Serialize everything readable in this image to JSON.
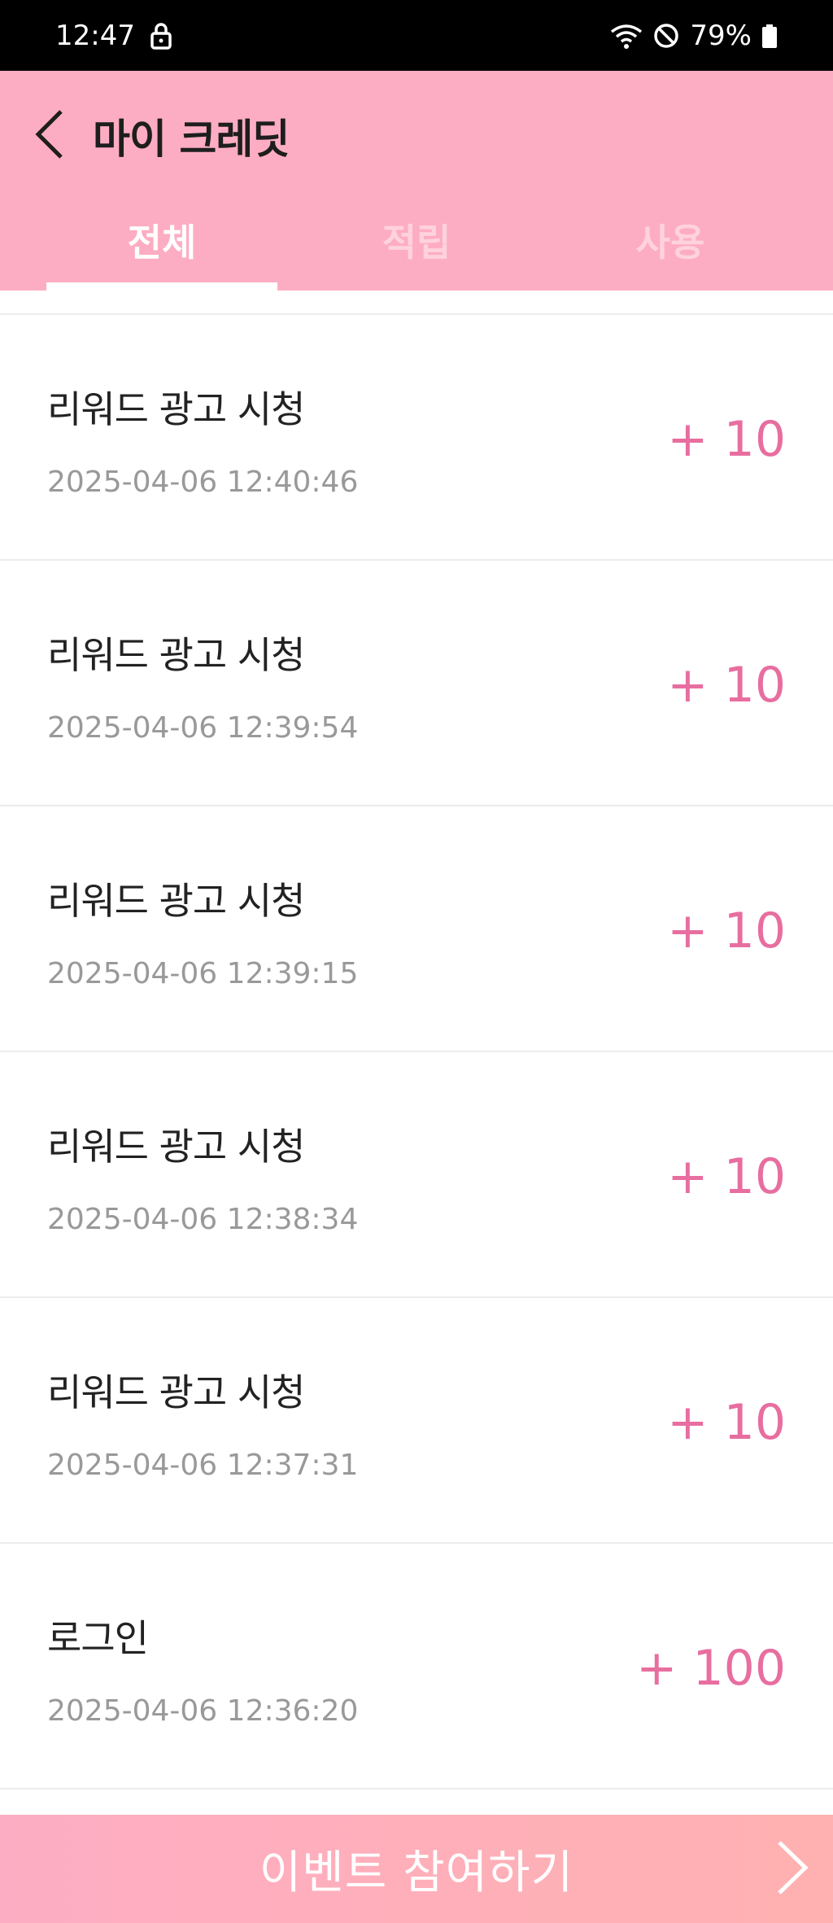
{
  "status_bar": {
    "time": "12:47",
    "battery": "79%",
    "icons": [
      "lock-icon",
      "wifi-icon",
      "do-not-disturb-icon",
      "battery-icon"
    ]
  },
  "header": {
    "title": "마이 크레딧",
    "back_icon": "chevron-left-icon",
    "tabs": [
      {
        "label": "전체",
        "active": true
      },
      {
        "label": "적립",
        "active": false
      },
      {
        "label": "사용",
        "active": false
      }
    ]
  },
  "transactions": [
    {
      "title": "리워드 광고 시청",
      "date": "2025-04-06 12:40:46",
      "amount": "+ 10"
    },
    {
      "title": "리워드 광고 시청",
      "date": "2025-04-06 12:39:54",
      "amount": "+ 10"
    },
    {
      "title": "리워드 광고 시청",
      "date": "2025-04-06 12:39:15",
      "amount": "+ 10"
    },
    {
      "title": "리워드 광고 시청",
      "date": "2025-04-06 12:38:34",
      "amount": "+ 10"
    },
    {
      "title": "리워드 광고 시청",
      "date": "2025-04-06 12:37:31",
      "amount": "+ 10"
    },
    {
      "title": "로그인",
      "date": "2025-04-06 12:36:20",
      "amount": "+ 100"
    }
  ],
  "event_button": {
    "label": "이벤트 참여하기",
    "icon": "chevron-right-icon"
  },
  "colors": {
    "header_bg": "#fdadc3",
    "accent": "#e86ea0",
    "date_text": "#999999"
  }
}
